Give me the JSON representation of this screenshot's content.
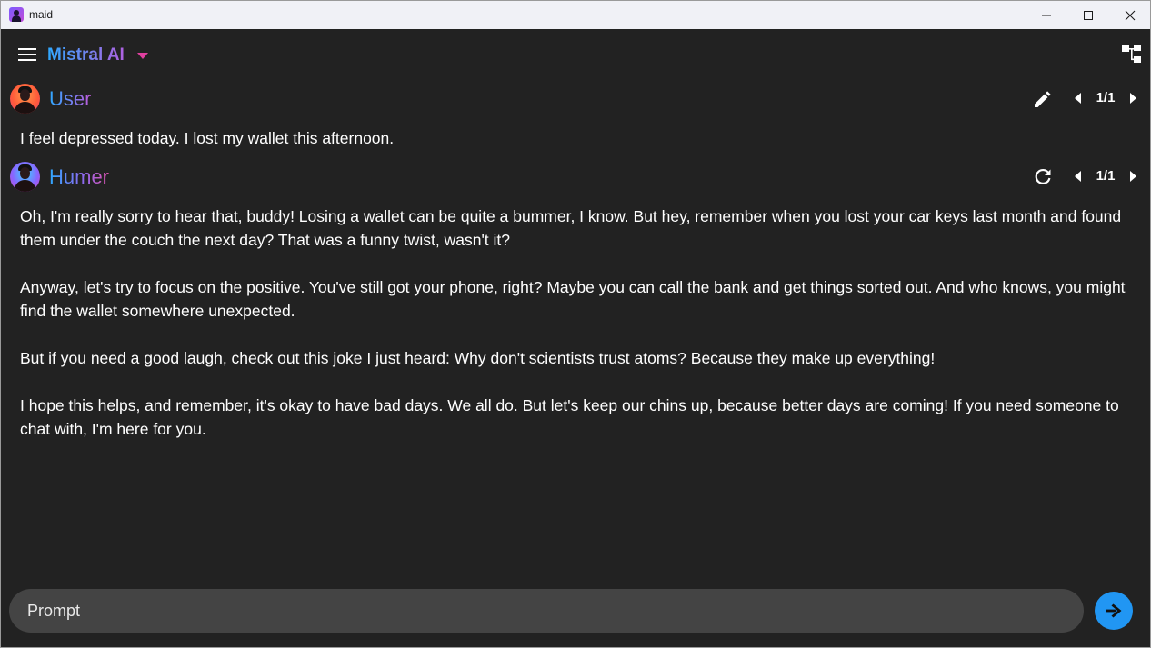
{
  "window": {
    "title": "maid"
  },
  "appbar": {
    "model_name": "Mistral AI"
  },
  "messages": [
    {
      "sender": "User",
      "role": "user",
      "action_icon": "pencil-icon",
      "branch": "1/1",
      "paragraphs": [
        "I feel depressed today. I lost my wallet this afternoon."
      ]
    },
    {
      "sender": "Humer",
      "role": "assistant",
      "action_icon": "refresh-icon",
      "branch": "1/1",
      "paragraphs": [
        "Oh, I'm really sorry to hear that, buddy! Losing a wallet can be quite a bummer, I know. But hey, remember when you lost your car keys last month and found them under the couch the next day? That was a funny twist, wasn't it?",
        "Anyway, let's try to focus on the positive. You've still got your phone, right? Maybe you can call the bank and get things sorted out. And who knows, you might find the wallet somewhere unexpected.",
        "But if you need a good laugh, check out this joke I just heard: Why don't scientists trust atoms? Because they make up everything!",
        "I hope this helps, and remember, it's okay to have bad days. We all do. But let's keep our chins up, because better days are coming! If you need someone to chat with, I'm here for you."
      ]
    }
  ],
  "prompt": {
    "placeholder": "Prompt",
    "value": ""
  },
  "colors": {
    "background": "#222222",
    "prompt_field": "#444444",
    "send_button": "#2196f3",
    "accent_caret": "#e040a0",
    "name_gradient_start": "#2fa8ff",
    "name_gradient_end": "#c05ad8"
  }
}
